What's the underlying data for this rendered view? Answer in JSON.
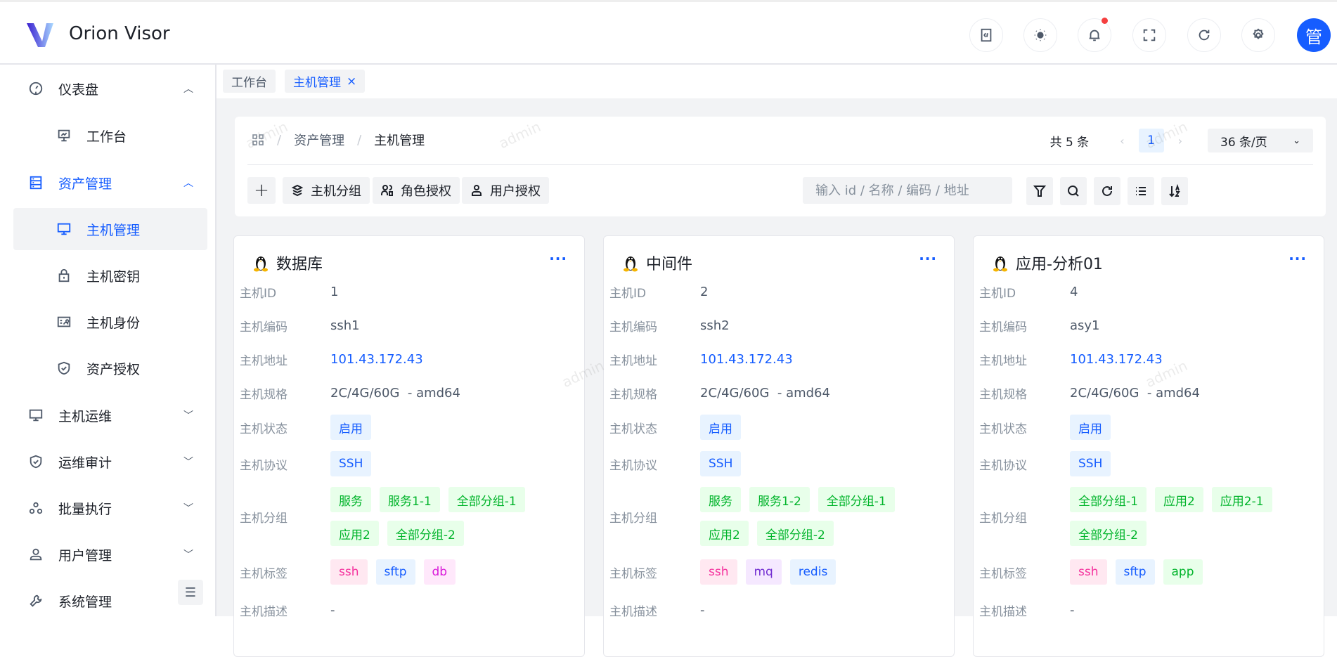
{
  "header": {
    "app_title": "Orion Visor",
    "avatar_text": "管",
    "icons": [
      "code-icon",
      "theme-icon",
      "bell-icon",
      "fullscreen-icon",
      "refresh-icon",
      "gear-icon"
    ]
  },
  "sidebar": {
    "items": [
      {
        "label": "仪表盘",
        "icon": "dashboard-icon",
        "level": 1,
        "chevron": "up"
      },
      {
        "label": "工作台",
        "icon": "workbench-icon",
        "level": 2
      },
      {
        "label": "资产管理",
        "icon": "storage-icon",
        "level": 1,
        "chevron": "up",
        "active_parent": true
      },
      {
        "label": "主机管理",
        "icon": "monitor-icon",
        "level": 2,
        "active": true
      },
      {
        "label": "主机密钥",
        "icon": "lock-icon",
        "level": 2
      },
      {
        "label": "主机身份",
        "icon": "id-card-icon",
        "level": 2
      },
      {
        "label": "资产授权",
        "icon": "shield-icon",
        "level": 2
      },
      {
        "label": "主机运维",
        "icon": "monitor-icon",
        "level": 1,
        "chevron": "down"
      },
      {
        "label": "运维审计",
        "icon": "shield-icon",
        "level": 1,
        "chevron": "down"
      },
      {
        "label": "批量执行",
        "icon": "nodes-icon",
        "level": 1,
        "chevron": "down"
      },
      {
        "label": "用户管理",
        "icon": "user-icon",
        "level": 1,
        "chevron": "down"
      },
      {
        "label": "系统管理",
        "icon": "wrench-icon",
        "level": 1
      }
    ]
  },
  "tabs": [
    {
      "label": "工作台"
    },
    {
      "label": "主机管理",
      "active": true,
      "close": "×"
    }
  ],
  "breadcrumb": [
    "资产管理",
    "主机管理"
  ],
  "breadcrumb_sep": "/",
  "pagination": {
    "total": "共 5 条",
    "page": "1",
    "page_size": "36 条/页",
    "prev": "‹",
    "next": "›"
  },
  "toolbar": {
    "add": "+",
    "group": "主机分组",
    "role_auth": "角色授权",
    "user_auth": "用户授权",
    "search_placeholder": "输入 id / 名称 / 编码 / 地址"
  },
  "labels": {
    "id": "主机ID",
    "code": "主机编码",
    "address": "主机地址",
    "spec": "主机规格",
    "status": "主机状态",
    "protocol": "主机协议",
    "groups": "主机分组",
    "tags": "主机标签",
    "desc": "主机描述"
  },
  "more": "···",
  "watermark": "admin",
  "hosts": [
    {
      "name": "数据库",
      "id": "1",
      "code": "ssh1",
      "address": "101.43.172.43",
      "spec": "2C/4G/60G  - amd64",
      "status": "启用",
      "protocol": "SSH",
      "groups": [
        "服务",
        "服务1-1",
        "全部分组-1",
        "应用2",
        "全部分组-2"
      ],
      "tags": [
        {
          "t": "ssh",
          "c": "pink"
        },
        {
          "t": "sftp",
          "c": "blue"
        },
        {
          "t": "db",
          "c": "magenta"
        }
      ],
      "desc": "-"
    },
    {
      "name": "中间件",
      "id": "2",
      "code": "ssh2",
      "address": "101.43.172.43",
      "spec": "2C/4G/60G  - amd64",
      "status": "启用",
      "protocol": "SSH",
      "groups": [
        "服务",
        "服务1-2",
        "全部分组-1",
        "应用2",
        "全部分组-2"
      ],
      "tags": [
        {
          "t": "ssh",
          "c": "pink"
        },
        {
          "t": "mq",
          "c": "purple"
        },
        {
          "t": "redis",
          "c": "blue"
        }
      ],
      "desc": "-"
    },
    {
      "name": "应用-分析01",
      "id": "4",
      "code": "asy1",
      "address": "101.43.172.43",
      "spec": "2C/4G/60G  - amd64",
      "status": "启用",
      "protocol": "SSH",
      "groups": [
        "全部分组-1",
        "应用2",
        "应用2-1",
        "全部分组-2"
      ],
      "tags": [
        {
          "t": "ssh",
          "c": "pink"
        },
        {
          "t": "sftp",
          "c": "blue"
        },
        {
          "t": "app",
          "c": "green"
        }
      ],
      "desc": "-"
    }
  ],
  "colors": {
    "primary": "#165dff",
    "tag_blue_bg": "#e8f3ff",
    "tag_green_bg": "#e8ffea",
    "tag_green": "#00b42a",
    "tag_pink_bg": "#ffe8f1",
    "tag_pink": "#f5319d",
    "tag_magenta_bg": "#ffe8fb",
    "tag_magenta": "#d91ad9",
    "tag_purple_bg": "#f5e8ff",
    "tag_purple": "#722ed1"
  }
}
